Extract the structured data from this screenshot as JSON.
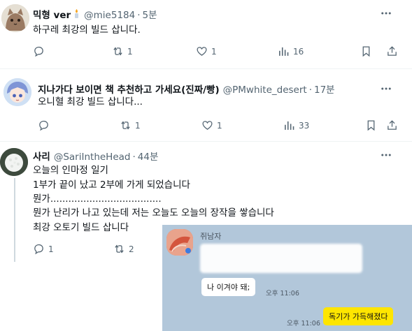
{
  "tweets": [
    {
      "name": "믹형 ver",
      "handle": "@mie5184",
      "time": "5분",
      "text": "하구레 최강의 빌드 삽니다.",
      "stats": {
        "replies": "",
        "retweets": "1",
        "likes": "1",
        "views": "16"
      }
    },
    {
      "name": "지나가다 보이면 책 추천하고 가세요(진짜/빵)",
      "handle": "@PMwhite_desert",
      "time": "17분",
      "text": "오니혈 최강 빌드 삽니다...",
      "stats": {
        "replies": "",
        "retweets": "1",
        "likes": "1",
        "views": "33"
      }
    },
    {
      "name": "사리",
      "handle": "@SariIntheHead",
      "time": "44분",
      "text_lines": [
        "오늘의 인마정 일기",
        "1부가 끝이 났고 2부에 가게 되었습니다",
        "뭔가.....................................",
        "뭔가 난리가 나고 있는데 저는 오늘도 오늘의 장작을 쌓습니다",
        "최강 오토기 빌드 삽니다"
      ],
      "stats": {
        "replies": "1",
        "retweets": "2"
      }
    }
  ],
  "separator": "·",
  "kakao": {
    "sender": "쥐남자",
    "msg1": "나 이겨야 돼;",
    "time1": "오후 11:06",
    "reply": "독기가 가득해졌다",
    "time2": "오후 11:06"
  },
  "colors": {
    "text": "#0f1419",
    "muted": "#536471",
    "kakao_bg": "#b2c7da",
    "kakao_yellow": "#fee500"
  }
}
